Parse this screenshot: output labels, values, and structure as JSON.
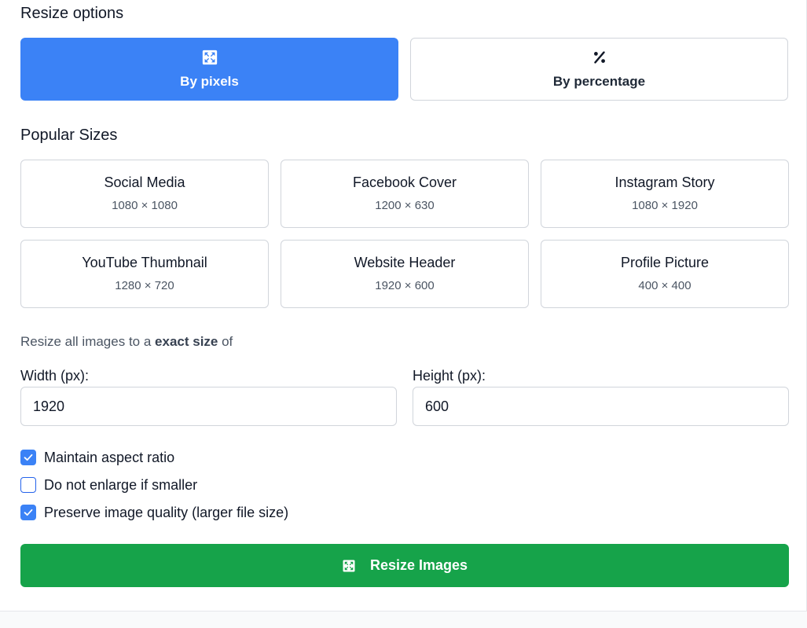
{
  "resize_options": {
    "title": "Resize options",
    "modes": [
      {
        "label": "By pixels",
        "icon": "expand-arrows-icon",
        "active": true
      },
      {
        "label": "By percentage",
        "icon": "percent-icon",
        "active": false
      }
    ]
  },
  "popular_sizes": {
    "title": "Popular Sizes",
    "presets": [
      {
        "name": "Social Media",
        "size": "1080 × 1080"
      },
      {
        "name": "Facebook Cover",
        "size": "1200 × 630"
      },
      {
        "name": "Instagram Story",
        "size": "1080 × 1920"
      },
      {
        "name": "YouTube Thumbnail",
        "size": "1280 × 720"
      },
      {
        "name": "Website Header",
        "size": "1920 × 600"
      },
      {
        "name": "Profile Picture",
        "size": "400 × 400"
      }
    ]
  },
  "description": {
    "prefix": "Resize all images to a ",
    "emphasis": "exact size",
    "suffix": " of"
  },
  "dimensions": {
    "width_label": "Width (px):",
    "width_value": "1920",
    "height_label": "Height (px):",
    "height_value": "600"
  },
  "options": [
    {
      "label": "Maintain aspect ratio",
      "checked": true
    },
    {
      "label": "Do not enlarge if smaller",
      "checked": false
    },
    {
      "label": "Preserve image quality (larger file size)",
      "checked": true
    }
  ],
  "action": {
    "label": "Resize Images",
    "icon": "expand-arrows-icon"
  },
  "colors": {
    "primary_blue": "#3b82f6",
    "action_green": "#16a34a"
  }
}
